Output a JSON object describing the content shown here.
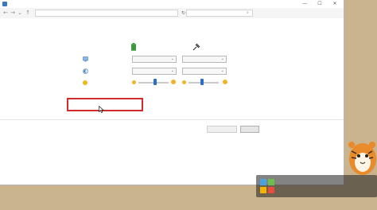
{
  "window": {
    "title": "",
    "minimize_glyph": "—",
    "maximize_glyph": "☐",
    "close_glyph": "✕"
  },
  "address": {
    "breadcrumbs": [
      "",
      "",
      "",
      ""
    ],
    "search_placeholder": ""
  },
  "content": {
    "heading": "",
    "subtext": "",
    "columns": {
      "battery": "",
      "plugged_in": ""
    },
    "rows": [
      {
        "label": "",
        "battery_value": "",
        "plugged_value": ""
      },
      {
        "label": "",
        "battery_value": "",
        "plugged_value": ""
      },
      {
        "label": "",
        "battery_brightness": 0.55,
        "plugged_brightness": 0.45
      }
    ],
    "links": {
      "advanced": "",
      "restore_defaults": ""
    }
  },
  "buttons": {
    "save": "",
    "cancel": ""
  },
  "taskbar": {
    "text": ""
  },
  "watermark": {
    "title": "",
    "url": ""
  },
  "colors": {
    "accent": "#2a70c8",
    "link": "#2a64c8",
    "highlight": "#d22b2b",
    "heading": "#1e3d8f"
  }
}
